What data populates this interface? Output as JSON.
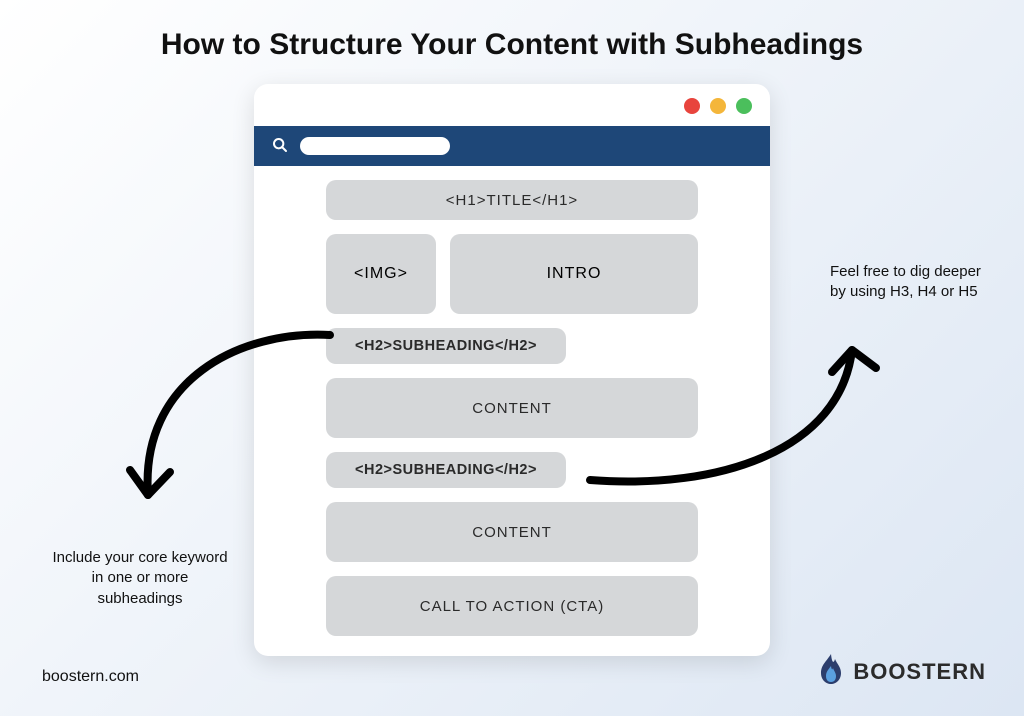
{
  "title": "How to Structure Your Content with Subheadings",
  "browser": {
    "layout": {
      "title_block": "<H1>TITLE</H1>",
      "img_block": "<IMG>",
      "intro_block": "INTRO",
      "subheading_1": "<H2>SUBHEADING</H2>",
      "content_1": "CONTENT",
      "subheading_2": "<H2>SUBHEADING</H2>",
      "content_2": "CONTENT",
      "cta_block": "CALL TO ACTION (CTA)"
    }
  },
  "callouts": {
    "left": "Include your core keyword in one or more subheadings",
    "right": "Feel free to dig deeper by using H3, H4 or H5"
  },
  "footer": {
    "domain": "boostern.com",
    "brand_name": "BOOSTERN"
  },
  "colors": {
    "urlbar": "#1e4778",
    "block_fill": "#d5d7d9",
    "dot_red": "#e8443d",
    "dot_yellow": "#f4b63a",
    "dot_green": "#4bbf5c",
    "brand_flame_outer": "#2c3e6d",
    "brand_flame_inner": "#5aa0e0"
  }
}
